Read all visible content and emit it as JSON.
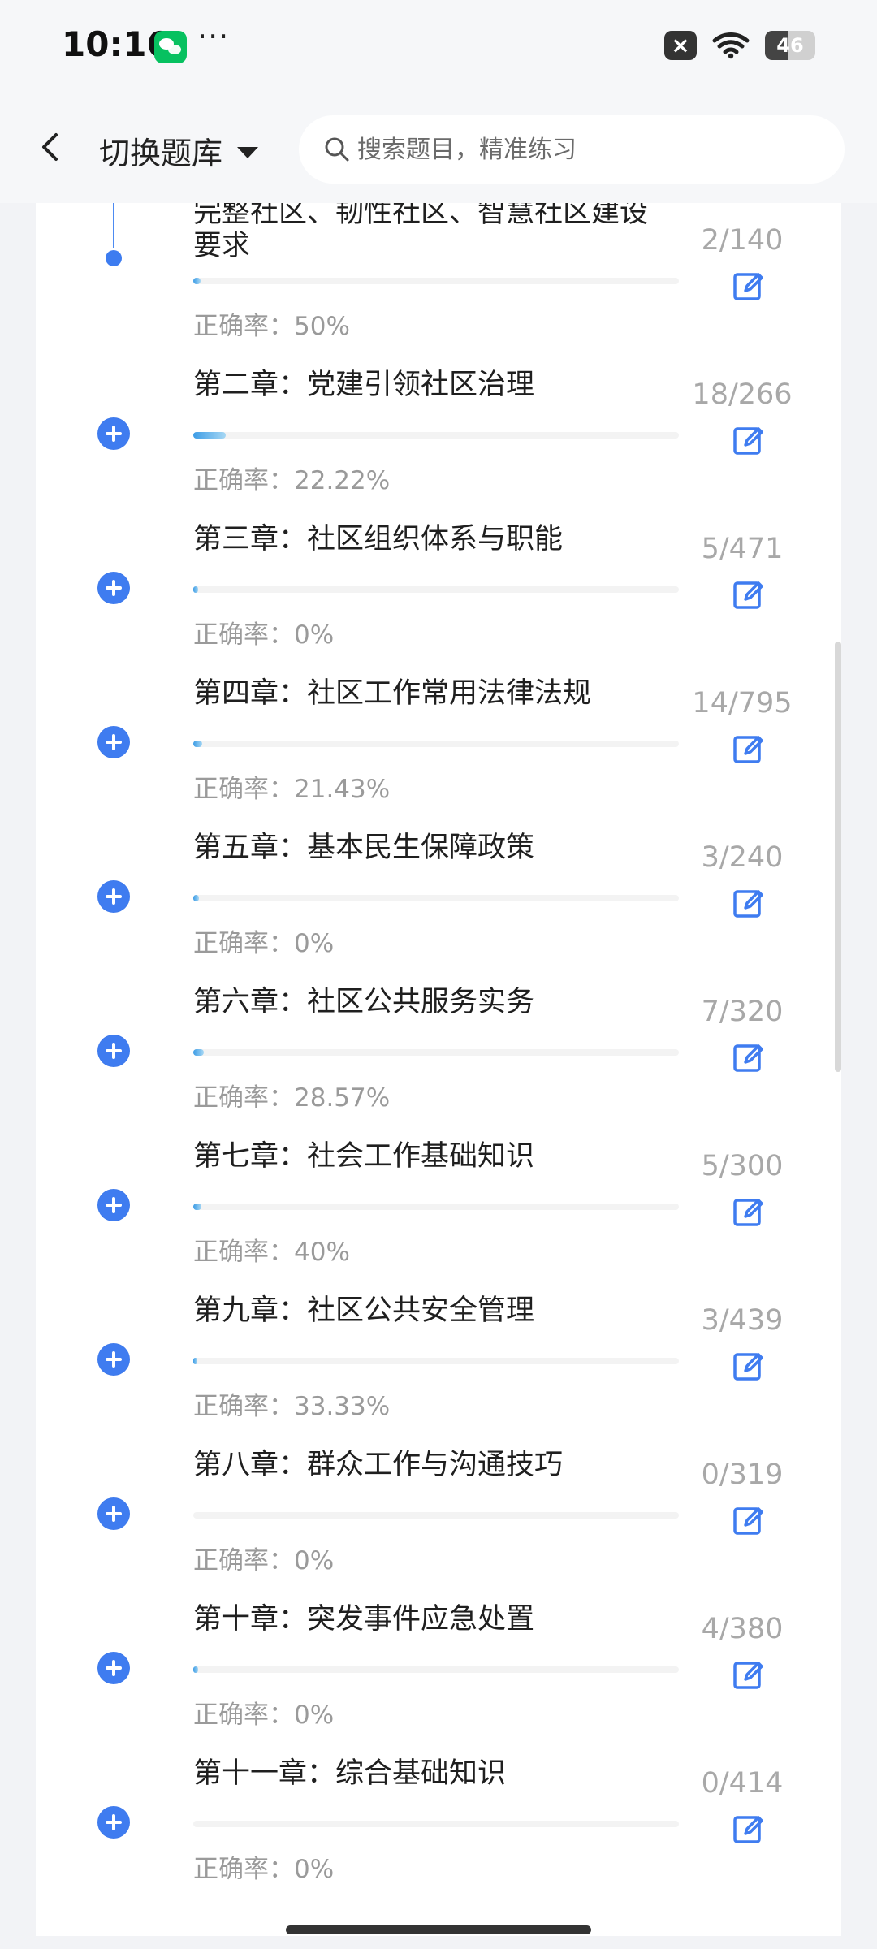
{
  "status_bar": {
    "time": "10:16",
    "dots": "···",
    "mute": "×",
    "battery": "46"
  },
  "nav": {
    "switch_label": "切换题库",
    "search_placeholder": "搜索题目，精准练习"
  },
  "chapters": [
    {
      "title": "完整社区、韧性社区、智慧社区建设要求",
      "count": "2/140",
      "accuracy": "正确率：50%",
      "progress": 0.0143
    },
    {
      "title": "第二章：党建引领社区治理",
      "count": "18/266",
      "accuracy": "正确率：22.22%",
      "progress": 0.0677
    },
    {
      "title": "第三章：社区组织体系与职能",
      "count": "5/471",
      "accuracy": "正确率：0%",
      "progress": 0.0106
    },
    {
      "title": "第四章：社区工作常用法律法规",
      "count": "14/795",
      "accuracy": "正确率：21.43%",
      "progress": 0.0176
    },
    {
      "title": "第五章：基本民生保障政策",
      "count": "3/240",
      "accuracy": "正确率：0%",
      "progress": 0.0125
    },
    {
      "title": "第六章：社区公共服务实务",
      "count": "7/320",
      "accuracy": "正确率：28.57%",
      "progress": 0.0219
    },
    {
      "title": "第七章：社会工作基础知识",
      "count": "5/300",
      "accuracy": "正确率：40%",
      "progress": 0.0167
    },
    {
      "title": "第九章：社区公共安全管理",
      "count": "3/439",
      "accuracy": "正确率：33.33%",
      "progress": 0.0068
    },
    {
      "title": "第八章：群众工作与沟通技巧",
      "count": "0/319",
      "accuracy": "正确率：0%",
      "progress": 0
    },
    {
      "title": "第十章：突发事件应急处置",
      "count": "4/380",
      "accuracy": "正确率：0%",
      "progress": 0.0105
    },
    {
      "title": "第十一章：综合基础知识",
      "count": "0/414",
      "accuracy": "正确率：0%",
      "progress": 0
    }
  ]
}
